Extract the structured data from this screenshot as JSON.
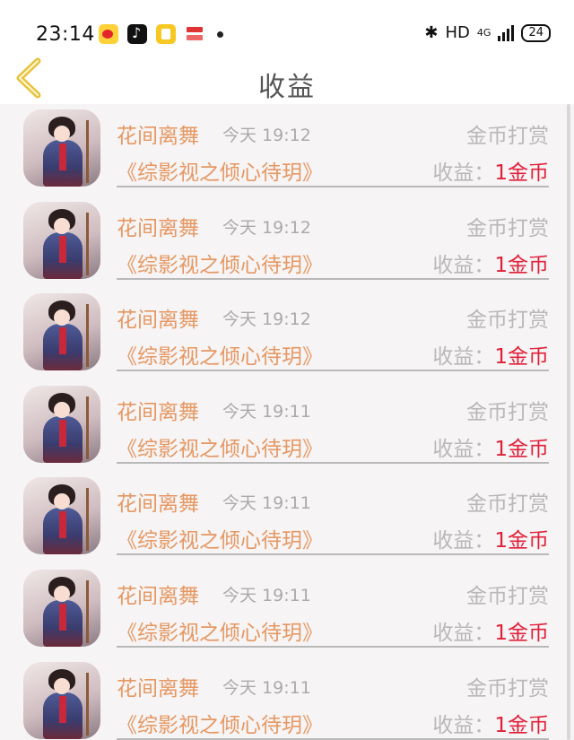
{
  "status_bar": {
    "time": "23:14",
    "network": "HD",
    "network_type": "4G",
    "battery": "24"
  },
  "header": {
    "title": "收益"
  },
  "records": [
    {
      "name": "花间离舞",
      "time": "今天 19:12",
      "type": "金币打赏",
      "book": "《综影视之倾心待玥》",
      "income_label": "收益：",
      "income_value": "1金币"
    },
    {
      "name": "花间离舞",
      "time": "今天 19:12",
      "type": "金币打赏",
      "book": "《综影视之倾心待玥》",
      "income_label": "收益：",
      "income_value": "1金币"
    },
    {
      "name": "花间离舞",
      "time": "今天 19:12",
      "type": "金币打赏",
      "book": "《综影视之倾心待玥》",
      "income_label": "收益：",
      "income_value": "1金币"
    },
    {
      "name": "花间离舞",
      "time": "今天 19:11",
      "type": "金币打赏",
      "book": "《综影视之倾心待玥》",
      "income_label": "收益：",
      "income_value": "1金币"
    },
    {
      "name": "花间离舞",
      "time": "今天 19:11",
      "type": "金币打赏",
      "book": "《综影视之倾心待玥》",
      "income_label": "收益：",
      "income_value": "1金币"
    },
    {
      "name": "花间离舞",
      "time": "今天 19:11",
      "type": "金币打赏",
      "book": "《综影视之倾心待玥》",
      "income_label": "收益：",
      "income_value": "1金币"
    },
    {
      "name": "花间离舞",
      "time": "今天 19:11",
      "type": "金币打赏",
      "book": "《综影视之倾心待玥》",
      "income_label": "收益：",
      "income_value": "1金币"
    }
  ],
  "colors": {
    "accent_orange": "#e59863",
    "income_red": "#e0213a",
    "back_arrow": "#e8c23c"
  }
}
